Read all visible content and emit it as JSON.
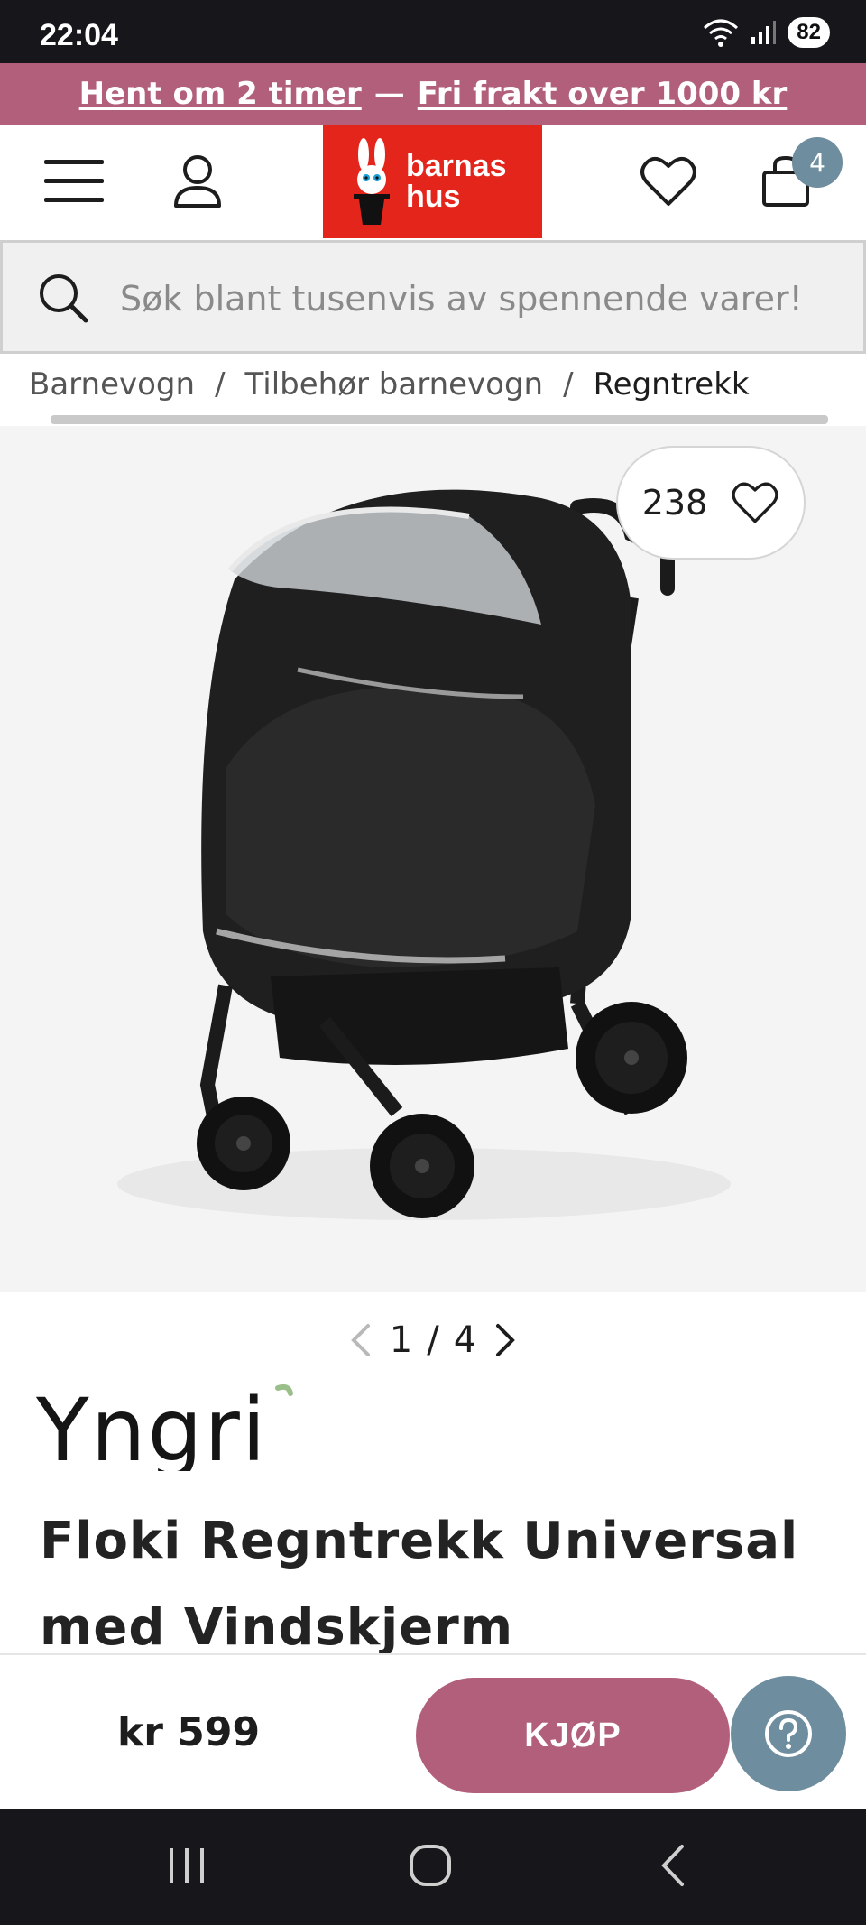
{
  "status_bar": {
    "time": "22:04",
    "battery": "82"
  },
  "promo": {
    "part1": "Hent om 2 timer",
    "separator": "—",
    "part2": "Fri frakt over 1000 kr"
  },
  "header": {
    "logo_line1": "barnas",
    "logo_line2": "hus",
    "cart_count": "4"
  },
  "search": {
    "placeholder": "Søk blant tusenvis av spennende varer!"
  },
  "breadcrumb": {
    "items": [
      "Barnevogn",
      "Tilbehør barnevogn",
      "Regntrekk"
    ],
    "separator": "/"
  },
  "product": {
    "favorites_count": "238",
    "pager": {
      "current": "1",
      "separator": "/",
      "total": "4"
    },
    "brand": "Yngri",
    "title": "Floki Regntrekk Universal med Vindskjerm"
  },
  "buy_bar": {
    "price": "kr 599",
    "buy_label": "KJØP"
  },
  "colors": {
    "accent": "#b25f7c",
    "logo_red": "#e4251b",
    "badge": "#6e8d9e"
  }
}
